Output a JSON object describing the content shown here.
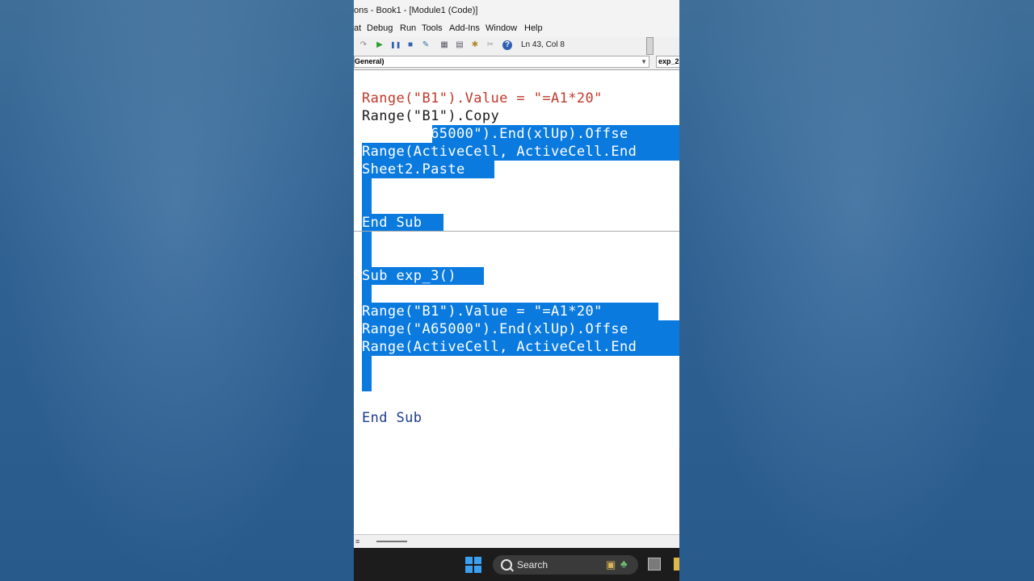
{
  "window": {
    "title": "ons - Book1 - [Module1 (Code)]"
  },
  "menu": [
    "at",
    "Debug",
    "Run",
    "Tools",
    "Add-Ins",
    "Window",
    "Help"
  ],
  "toolbar": {
    "position": "Ln 43, Col 8"
  },
  "combos": {
    "object": "General)",
    "procedure": "exp_2"
  },
  "code": {
    "lines": [
      "Range(\"B1\").Value = \"=A1*20\"",
      "Range(\"B1\").Copy",
      "Range(\"A65000\").End(xlUp).Offse",
      "Range(ActiveCell, ActiveCell.End",
      "Sheet2.Paste",
      "End Sub",
      "Sub exp_3()",
      "Range(\"B1\").Value = \"=A1*20\"",
      "Range(\"A65000\").End(xlUp).Offse",
      "Range(ActiveCell, ActiveCell.End",
      "End Sub"
    ]
  },
  "taskbar": {
    "search_label": "Search"
  },
  "colors": {
    "selection": "#0a7adf",
    "string": "#c0392b",
    "keyword": "#1f3b8a"
  }
}
